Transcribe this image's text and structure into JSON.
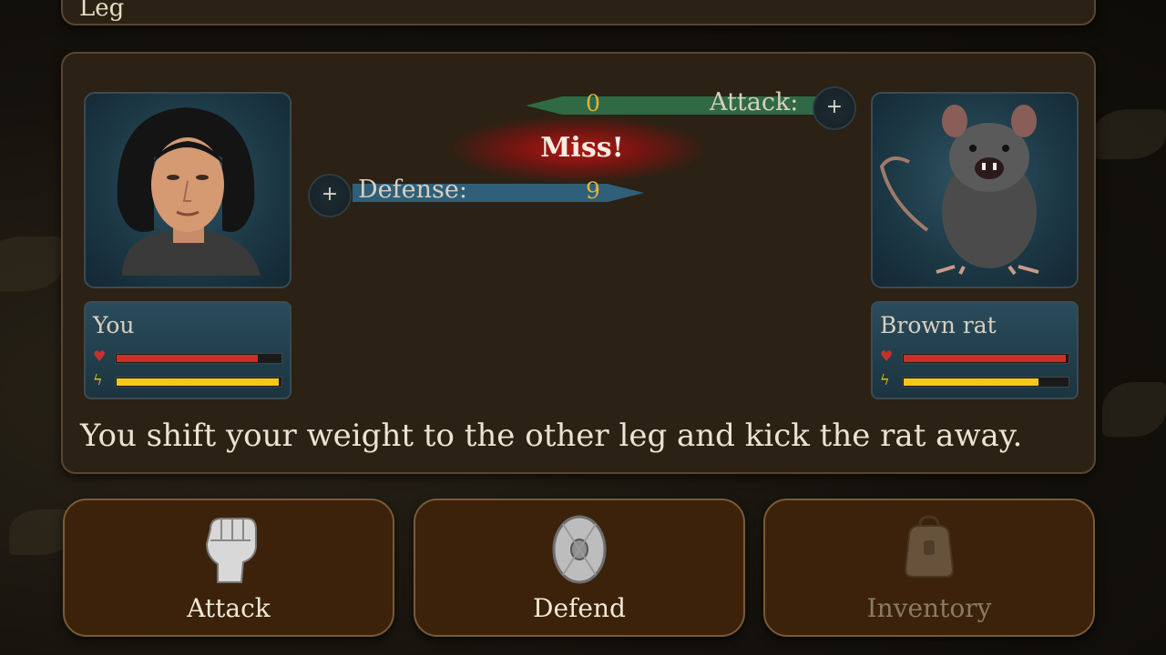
{
  "top_panel": {
    "partial_text": "Leg"
  },
  "player": {
    "name": "You",
    "health_fraction": 0.86,
    "energy_fraction": 0.99,
    "portrait": "long-haired-young-man-portrait"
  },
  "enemy": {
    "name": "Brown rat",
    "health_fraction": 0.99,
    "energy_fraction": 0.82,
    "portrait": "brown-rat-portrait"
  },
  "attack_stat": {
    "label": "Attack:",
    "value": "0",
    "color": "#2f6a45"
  },
  "defense_stat": {
    "label": "Defense:",
    "value": "9",
    "color": "#2f5f79"
  },
  "plus_symbol": "+",
  "result": {
    "text": "Miss!",
    "color": "#c01818"
  },
  "narration": "You shift your weight to the other leg and kick the rat away.",
  "actions": [
    {
      "label": "Attack",
      "icon": "fist-icon",
      "enabled": true
    },
    {
      "label": "Defend",
      "icon": "shield-icon",
      "enabled": true
    },
    {
      "label": "Inventory",
      "icon": "backpack-icon",
      "enabled": false
    }
  ],
  "colors": {
    "health": "#c9302c",
    "energy": "#f2c81d",
    "panel": "#2b2114",
    "button": "#3c220a",
    "value": "#e2b43b"
  }
}
